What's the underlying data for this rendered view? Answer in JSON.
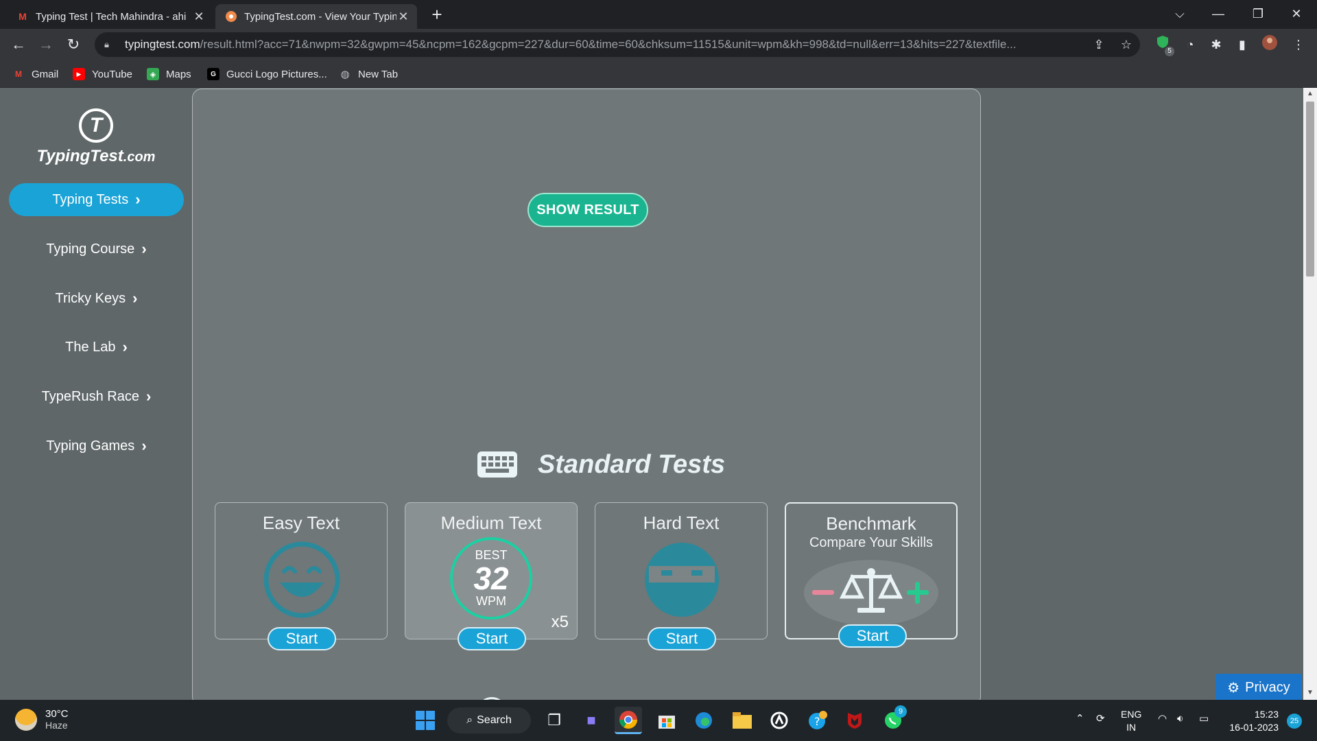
{
  "browser": {
    "tabs": [
      {
        "title": "Typing Test | Tech Mahindra - ahi",
        "favicon": "gmail-icon",
        "active": false
      },
      {
        "title": "TypingTest.com - View Your Typin",
        "favicon": "typingtest-icon",
        "active": true
      }
    ],
    "url_host": "typingtest.com",
    "url_rest": "/result.html?acc=71&nwpm=32&gwpm=45&ncpm=162&gcpm=227&dur=60&time=60&chksum=11515&unit=wpm&kh=998&td=null&err=13&hits=227&textfile...",
    "bookmarks": [
      {
        "label": "Gmail",
        "icon": "gmail-icon"
      },
      {
        "label": "YouTube",
        "icon": "youtube-icon"
      },
      {
        "label": "Maps",
        "icon": "maps-icon"
      },
      {
        "label": "Gucci Logo Pictures...",
        "icon": "gucci-icon"
      },
      {
        "label": "New Tab",
        "icon": "globe-icon"
      }
    ],
    "extension_badge": "5"
  },
  "site": {
    "logo_text": "TypingTest",
    "logo_suffix": ".com",
    "nav": [
      {
        "label": "Typing Tests",
        "active": true
      },
      {
        "label": "Typing Course",
        "active": false
      },
      {
        "label": "Tricky Keys",
        "active": false
      },
      {
        "label": "The Lab",
        "active": false
      },
      {
        "label": "TypeRush Race",
        "active": false
      },
      {
        "label": "Typing Games",
        "active": false
      }
    ],
    "show_result_label": "SHOW RESULT",
    "section_title": "Standard Tests",
    "tests": [
      {
        "name": "Easy Text",
        "start": "Start"
      },
      {
        "name": "Medium Text",
        "start": "Start",
        "best_label": "BEST",
        "best_value": "32",
        "best_unit": "WPM",
        "multiplier": "x5"
      },
      {
        "name": "Hard Text",
        "start": "Start"
      },
      {
        "name": "Benchmark",
        "subtitle": "Compare Your Skills",
        "start": "Start"
      }
    ],
    "privacy_label": "Privacy"
  },
  "taskbar": {
    "temperature": "30°C",
    "condition": "Haze",
    "search_label": "Search",
    "lang_line1": "ENG",
    "lang_line2": "IN",
    "time": "15:23",
    "date": "16-01-2023",
    "notification_count": "25",
    "whatsapp_badge": "9"
  },
  "colors": {
    "accent_blue": "#1aa3d6",
    "show_result_green": "#1ab590",
    "best_ring": "#1ad1a3",
    "face_teal": "#2a8a9c",
    "privacy_blue": "#1a74c9"
  }
}
